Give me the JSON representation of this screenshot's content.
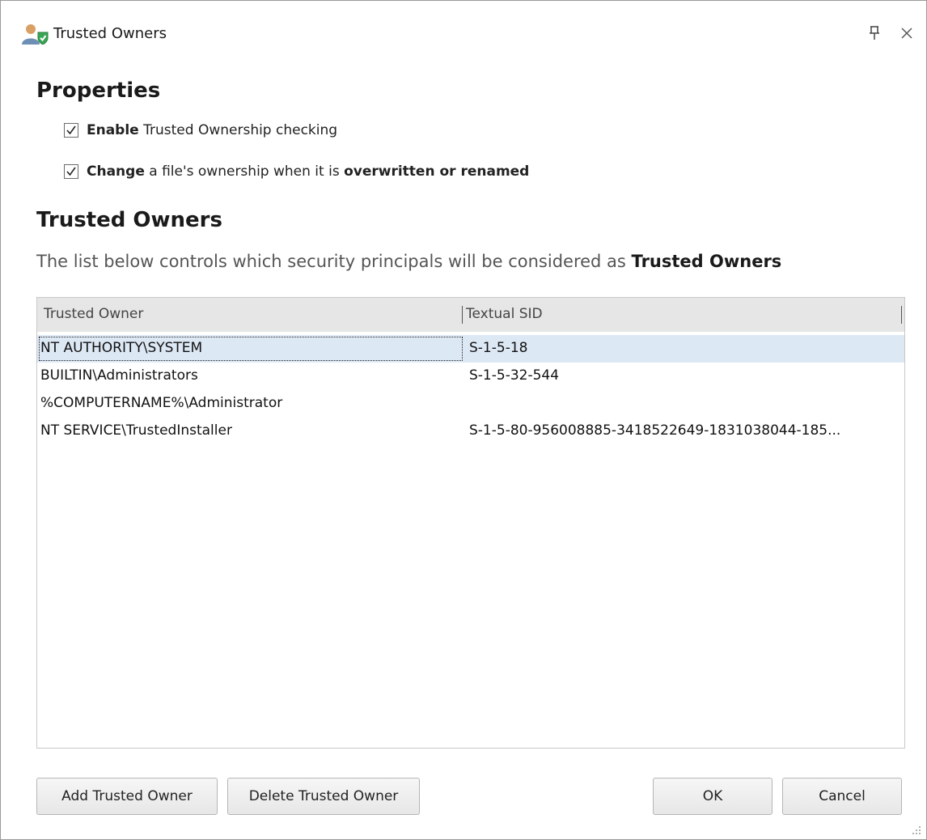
{
  "window": {
    "title": "Trusted Owners"
  },
  "properties": {
    "heading": "Properties",
    "options": [
      {
        "checked": true,
        "bold": "Enable",
        "text": " Trusted Ownership checking",
        "bold2": ""
      },
      {
        "checked": true,
        "bold": "Change",
        "text": " a file's ownership when it is ",
        "bold2": "overwritten or renamed"
      }
    ]
  },
  "trusted_owners": {
    "heading": "Trusted Owners",
    "description": "The list below controls which security principals will be considered as ",
    "description_bold": "Trusted Owners",
    "columns": [
      "Trusted Owner",
      "Textual SID"
    ],
    "rows": [
      {
        "owner": "NT AUTHORITY\\SYSTEM",
        "sid": "S-1-5-18",
        "selected": true
      },
      {
        "owner": "BUILTIN\\Administrators",
        "sid": "S-1-5-32-544",
        "selected": false
      },
      {
        "owner": "%COMPUTERNAME%\\Administrator",
        "sid": "",
        "selected": false
      },
      {
        "owner": "NT SERVICE\\TrustedInstaller",
        "sid": "S-1-5-80-956008885-3418522649-1831038044-185...",
        "selected": false
      }
    ]
  },
  "buttons": {
    "add": "Add Trusted Owner",
    "delete": "Delete Trusted Owner",
    "ok": "OK",
    "cancel": "Cancel"
  },
  "icons": {
    "title": "user-shield-icon",
    "pin": "pin-icon",
    "close": "close-icon",
    "grip": "resize-grip-icon"
  },
  "colors": {
    "selected_row": "#dde8f5",
    "header_bg": "#e6e6e6",
    "shield_green": "#3aa655"
  }
}
